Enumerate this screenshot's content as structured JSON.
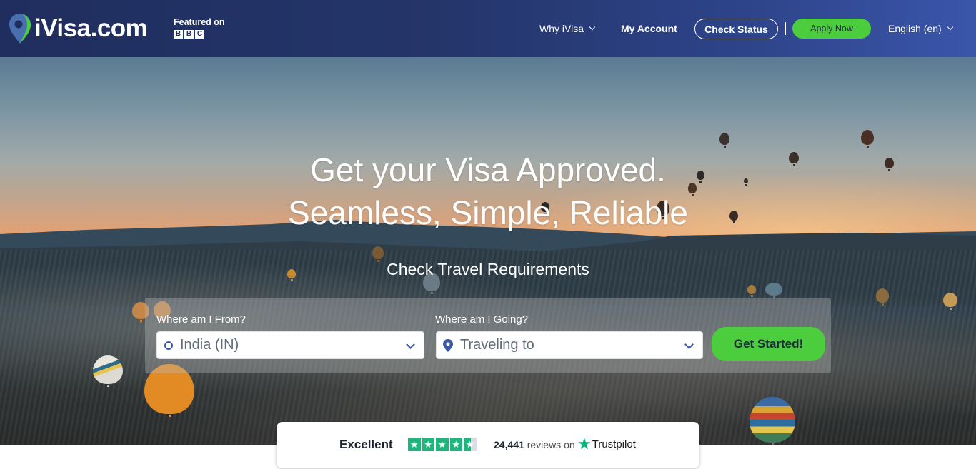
{
  "header": {
    "logo_text": "iVisa.com",
    "featured_label": "Featured on",
    "featured_brand_letters": [
      "B",
      "B",
      "C"
    ],
    "nav": {
      "why": "Why iVisa",
      "account": "My Account",
      "check_status": "Check Status",
      "apply_now": "Apply Now",
      "language": "English (en)"
    }
  },
  "hero": {
    "title_line1": "Get your Visa Approved.",
    "title_line2": "Seamless, Simple, Reliable",
    "subtitle": "Check Travel Requirements",
    "search": {
      "from_label": "Where am I From?",
      "from_value": "India (IN)",
      "to_label": "Where am I Going?",
      "to_placeholder": "Traveling to",
      "submit_label": "Get Started!"
    }
  },
  "trustpilot": {
    "rating_label": "Excellent",
    "stars": 4.5,
    "star_glyph": "★",
    "review_count": "24,441",
    "reviews_suffix": "reviews on",
    "brand": "Trustpilot"
  },
  "colors": {
    "nav_dark": "#1f2e5e",
    "nav_light": "#3a56aa",
    "accent_green": "#4ccd3d",
    "icon_blue": "#3b57a8",
    "trustpilot_green": "#21b57d"
  }
}
